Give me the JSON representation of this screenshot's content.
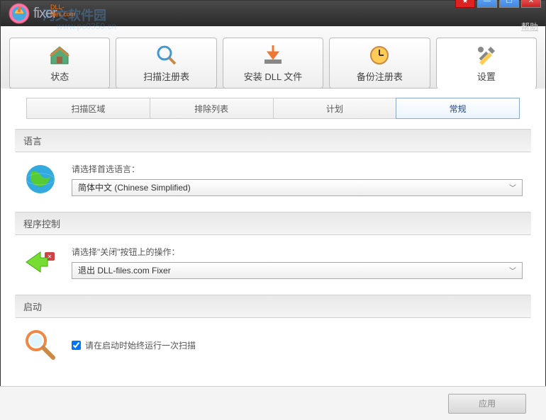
{
  "titlebar": {
    "logo_text": "fixer",
    "logo_badge": "DLL-files.com",
    "help_label": "帮助"
  },
  "watermark": {
    "line1": "河文软件园",
    "line2": "www.pc0359.cn"
  },
  "main_tabs": [
    {
      "label": "状态"
    },
    {
      "label": "扫描注册表"
    },
    {
      "label": "安装 DLL 文件"
    },
    {
      "label": "备份注册表"
    },
    {
      "label": "设置"
    }
  ],
  "sub_tabs": [
    {
      "label": "扫描区域"
    },
    {
      "label": "排除列表"
    },
    {
      "label": "计划"
    },
    {
      "label": "常规"
    }
  ],
  "sections": {
    "language": {
      "header": "语言",
      "label": "请选择首选语言：",
      "value": "简体中文 (Chinese Simplified)"
    },
    "program_control": {
      "header": "程序控制",
      "label": "请选择\"关闭\"按钮上的操作：",
      "value": "退出 DLL-files.com Fixer"
    },
    "startup": {
      "header": "启动",
      "checkbox_label": "请在启动时始终运行一次扫描"
    }
  },
  "footer": {
    "apply_label": "应用"
  }
}
